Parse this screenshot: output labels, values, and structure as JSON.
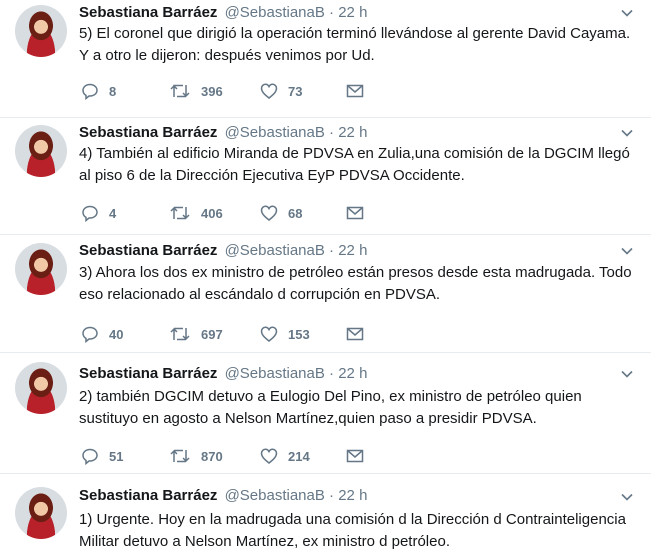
{
  "icons": {
    "reply": "reply-icon",
    "retweet": "retweet-icon",
    "like": "heart-icon",
    "dm": "envelope-icon",
    "caret": "chevron-down-icon"
  },
  "colors": {
    "text": "#14171a",
    "muted": "#657786",
    "divider": "#e6ecf0"
  },
  "tweets": [
    {
      "name": "Sebastiana Barráez",
      "handle": "@SebastianaB",
      "dot": "·",
      "time": "22 h",
      "text": "5) El coronel que dirigió la operación terminó llevándose al gerente David Cayama. Y a otro le dijeron: después venimos por Ud.",
      "replies": "8",
      "retweets": "396",
      "likes": "73"
    },
    {
      "name": "Sebastiana Barráez",
      "handle": "@SebastianaB",
      "dot": "·",
      "time": "22 h",
      "text": "4) También al edificio Miranda de PDVSA en Zulia,una comisión de la DGCIM llegó al piso 6 de la Dirección Ejecutiva EyP PDVSA Occidente.",
      "replies": "4",
      "retweets": "406",
      "likes": "68"
    },
    {
      "name": "Sebastiana Barráez",
      "handle": "@SebastianaB",
      "dot": "·",
      "time": "22 h",
      "text": "3) Ahora los dos ex ministro de petróleo están presos desde esta madrugada. Todo eso relacionado al escándalo d corrupción en PDVSA.",
      "replies": "40",
      "retweets": "697",
      "likes": "153"
    },
    {
      "name": "Sebastiana Barráez",
      "handle": "@SebastianaB",
      "dot": "·",
      "time": "22 h",
      "text": "2) también DGCIM detuvo a Eulogio Del Pino, ex ministro de petróleo quien sustituyo en agosto a Nelson Martínez,quien paso a presidir PDVSA.",
      "replies": "51",
      "retweets": "870",
      "likes": "214"
    },
    {
      "name": "Sebastiana Barráez",
      "handle": "@SebastianaB",
      "dot": "·",
      "time": "22 h",
      "text": "1) Urgente. Hoy en la madrugada una comisión d la Dirección d Contrainteligencia Militar detuvo a Nelson Martínez, ex ministro d petróleo."
    }
  ]
}
